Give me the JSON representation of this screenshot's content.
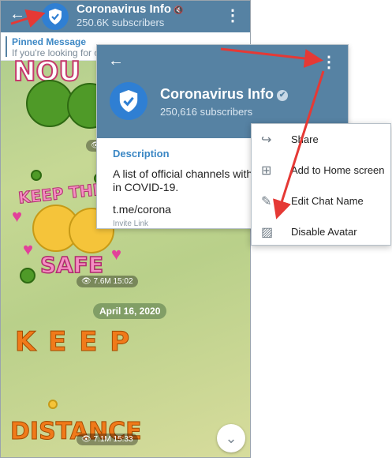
{
  "chat": {
    "title": "Coronavirus Info",
    "mute_icon": "🔇",
    "subscribers": "250.6K subscribers",
    "pinned_label": "Pinned Message",
    "pinned_preview": "If you're looking for o",
    "stickers": {
      "nou_text": "NOU",
      "keep_the": "KEEP THE",
      "safe": "SAFE",
      "keep": "K E E P",
      "distance": "DISTANCE"
    },
    "msg1_meta": "👁 7.6M  15:02",
    "date_pill": "April 16, 2020",
    "msg2_meta": "👁 7.1M  15:33",
    "partial_meta": "👁"
  },
  "info": {
    "title": "Coronavirus Info",
    "verified_mark": "✔",
    "subscribers": "250,616 subscribers",
    "description_label": "Description",
    "description_text": "A list of official channels with in COVID-19.",
    "invite_link": "t.me/corona",
    "invite_label": "Invite Link"
  },
  "menu": {
    "items": [
      {
        "label": "Share",
        "icon": "share-icon",
        "glyph": "↪"
      },
      {
        "label": "Add to Home screen",
        "icon": "add-home-icon",
        "glyph": "⊞"
      },
      {
        "label": "Edit Chat Name",
        "icon": "pencil-icon",
        "glyph": "✎"
      },
      {
        "label": "Disable Avatar",
        "icon": "image-off-icon",
        "glyph": "▨"
      }
    ]
  },
  "colors": {
    "header": "#5682a3",
    "accent": "#3b87c4",
    "annotation_arrow": "#e53935"
  }
}
